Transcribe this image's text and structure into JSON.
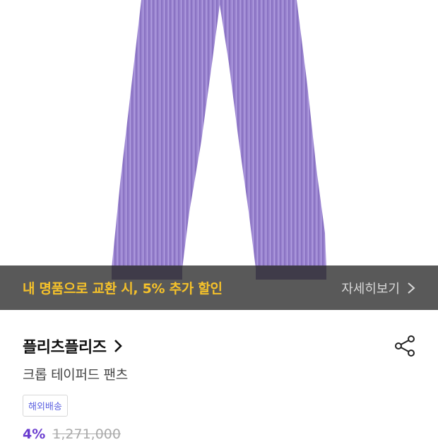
{
  "hero": {
    "image": "purple-pleated-pants-photo",
    "colors": {
      "pants": "#9b85d0",
      "pants_shadow": "#7e68b6",
      "pants_highlight": "#b3a2e0"
    }
  },
  "promo": {
    "text": "내 명품으로 교환 시, 5% 추가 할인",
    "link_label": "자세히보기",
    "link_icon": "chevron-right-icon",
    "accent": "#f6c22a"
  },
  "product": {
    "brand": "플리츠플리즈",
    "brand_icon": "chevron-right-icon",
    "name": "크롭 테이퍼드 팬츠",
    "tag": "해외배송",
    "share_icon": "share-icon"
  },
  "price": {
    "discount": "4%",
    "original": "1,271,000",
    "accent": "#6a3ccf"
  }
}
